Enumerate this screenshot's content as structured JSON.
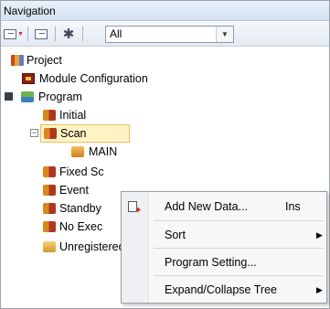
{
  "window": {
    "title": "Navigation"
  },
  "toolbar": {
    "filter_value": "All",
    "icons": [
      "tree-collapse-icon",
      "tree-expand-icon",
      "settings-gear-icon",
      "dropdown-arrow-icon"
    ]
  },
  "tree": {
    "items": [
      {
        "label": "Project",
        "icon": "project-icon"
      },
      {
        "label": "Module Configuration",
        "icon": "module-configuration-icon"
      },
      {
        "label": "Program",
        "icon": "program-folder-icon"
      },
      {
        "label": "Initial",
        "icon": "program-type-icon"
      },
      {
        "label": "Scan",
        "icon": "program-type-icon",
        "selected": true
      },
      {
        "label": "MAIN",
        "icon": "program-block-icon"
      },
      {
        "label": "Fixed Sc",
        "icon": "program-type-icon"
      },
      {
        "label": "Event",
        "icon": "program-type-icon"
      },
      {
        "label": "Standby",
        "icon": "program-type-icon"
      },
      {
        "label": "No Exec",
        "icon": "program-type-icon"
      },
      {
        "label": "Unregistered Program",
        "icon": "unregistered-program-icon"
      }
    ]
  },
  "context_menu": {
    "items": [
      {
        "label": "Add New Data...",
        "shortcut": "Ins",
        "icon": "new-data-icon"
      },
      {
        "label": "Sort",
        "submenu": true
      },
      {
        "label": "Program Setting..."
      },
      {
        "label": "Expand/Collapse Tree",
        "submenu": true
      }
    ]
  },
  "colors": {
    "selection_bg": "#fff3c6",
    "selection_border": "#e7c35a",
    "title_bg": "#dce7f4"
  }
}
